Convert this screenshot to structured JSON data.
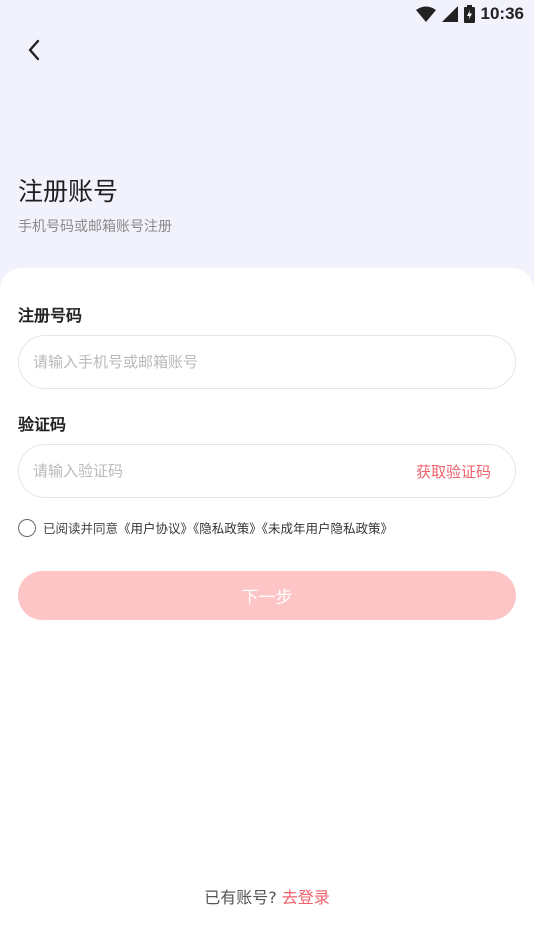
{
  "status_bar": {
    "time": "10:36",
    "icons": [
      "wifi-icon",
      "cellular-signal-icon",
      "battery-charging-icon"
    ]
  },
  "header": {
    "back_icon": "chevron-left-icon",
    "title": "注册账号",
    "subtitle": "手机号码或邮箱账号注册"
  },
  "form": {
    "phone": {
      "label": "注册号码",
      "placeholder": "请输入手机号或邮箱账号",
      "value": ""
    },
    "code": {
      "label": "验证码",
      "placeholder": "请输入验证码",
      "value": "",
      "get_code_label": "获取验证码"
    },
    "agreement": {
      "checked": false,
      "prefix": "已阅读并同意",
      "user_agreement": "《用户协议》",
      "privacy_policy": "《隐私政策》",
      "minor_privacy_policy": "《未成年用户隐私政策》"
    },
    "next_label": "下一步"
  },
  "footer": {
    "prompt": "已有账号?",
    "login_label": "去登录"
  },
  "colors": {
    "accent": "#f0616b",
    "button_disabled": "#fec5c6",
    "header_bg": "#f2f2fd",
    "card_bg": "#ffffff"
  }
}
